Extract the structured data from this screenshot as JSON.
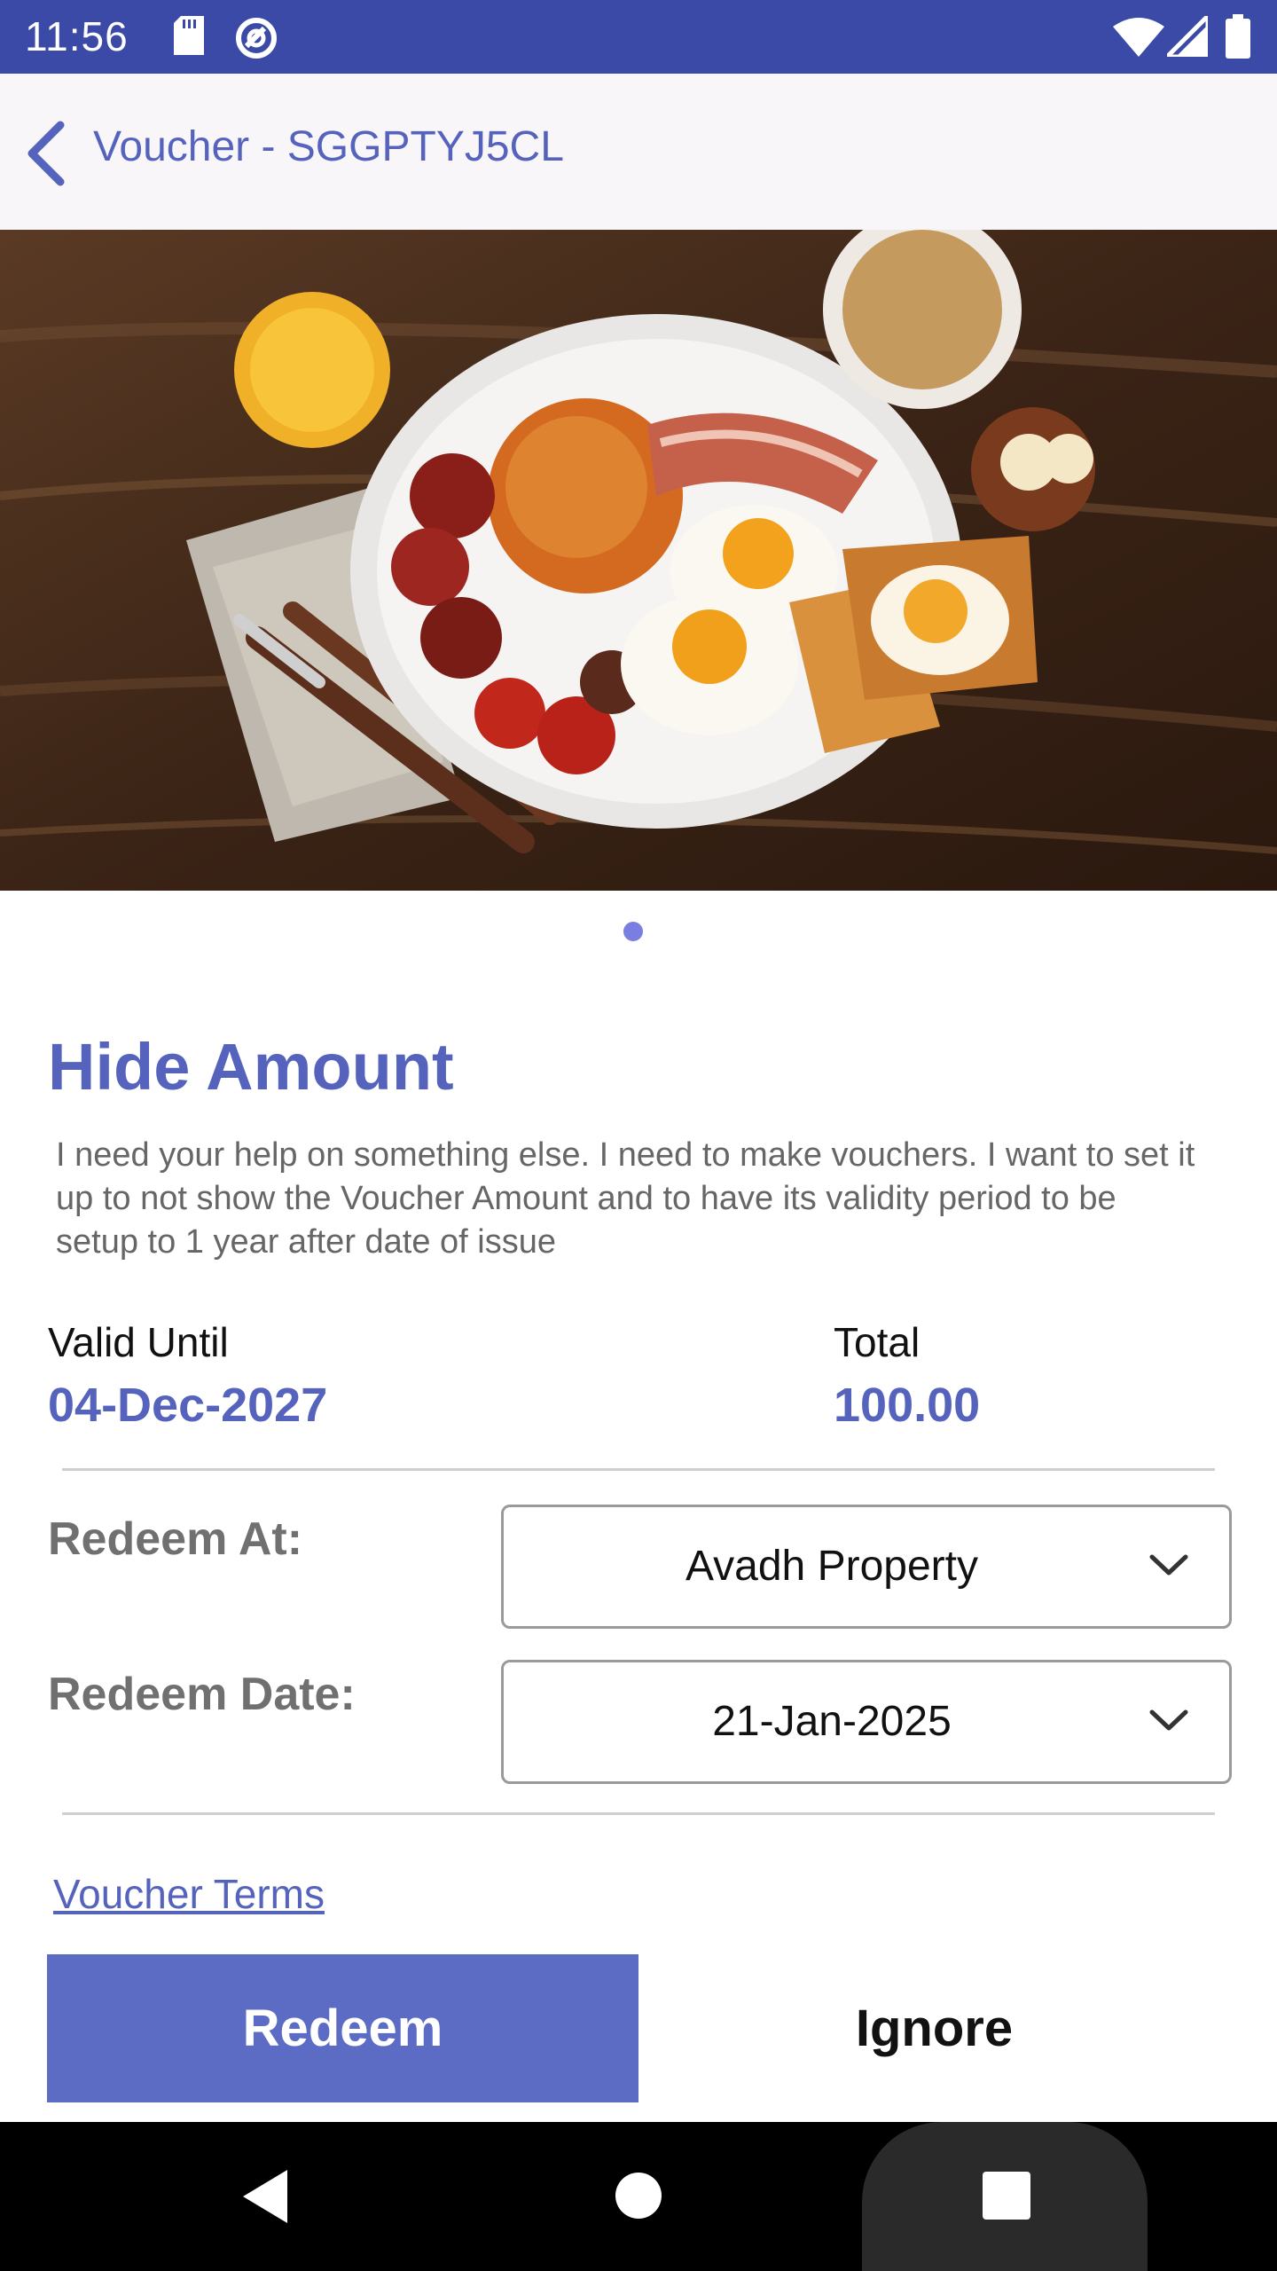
{
  "status_bar": {
    "time": "11:56",
    "icons": [
      "sd-card-icon",
      "sync-icon",
      "wifi-icon",
      "signal-icon",
      "battery-icon"
    ]
  },
  "app_bar": {
    "title": "Voucher - SGGPTYJ5CL",
    "back_icon": "chevron-left-icon"
  },
  "hero": {
    "image": "breakfast-plate-photo",
    "page_indicator": {
      "count": 1,
      "active": 1
    }
  },
  "voucher": {
    "title": "Hide Amount",
    "description": "I need your help on something else. I need to make vouchers. I want to set it up to not show the Voucher Amount and to have its validity period to be setup to 1 year after date of issue",
    "valid_until_label": "Valid Until",
    "valid_until_value": "04-Dec-2027",
    "total_label": "Total",
    "total_value": "100.00"
  },
  "redeem": {
    "at_label": "Redeem At:",
    "at_value": "Avadh Property",
    "date_label": "Redeem Date:",
    "date_value": "21-Jan-2025"
  },
  "links": {
    "terms": "Voucher Terms"
  },
  "actions": {
    "redeem": "Redeem",
    "ignore": "Ignore"
  },
  "colors": {
    "accent": "#5563bd",
    "status_bar": "#3a4aa6",
    "redeem_button": "#5c6bc4"
  }
}
